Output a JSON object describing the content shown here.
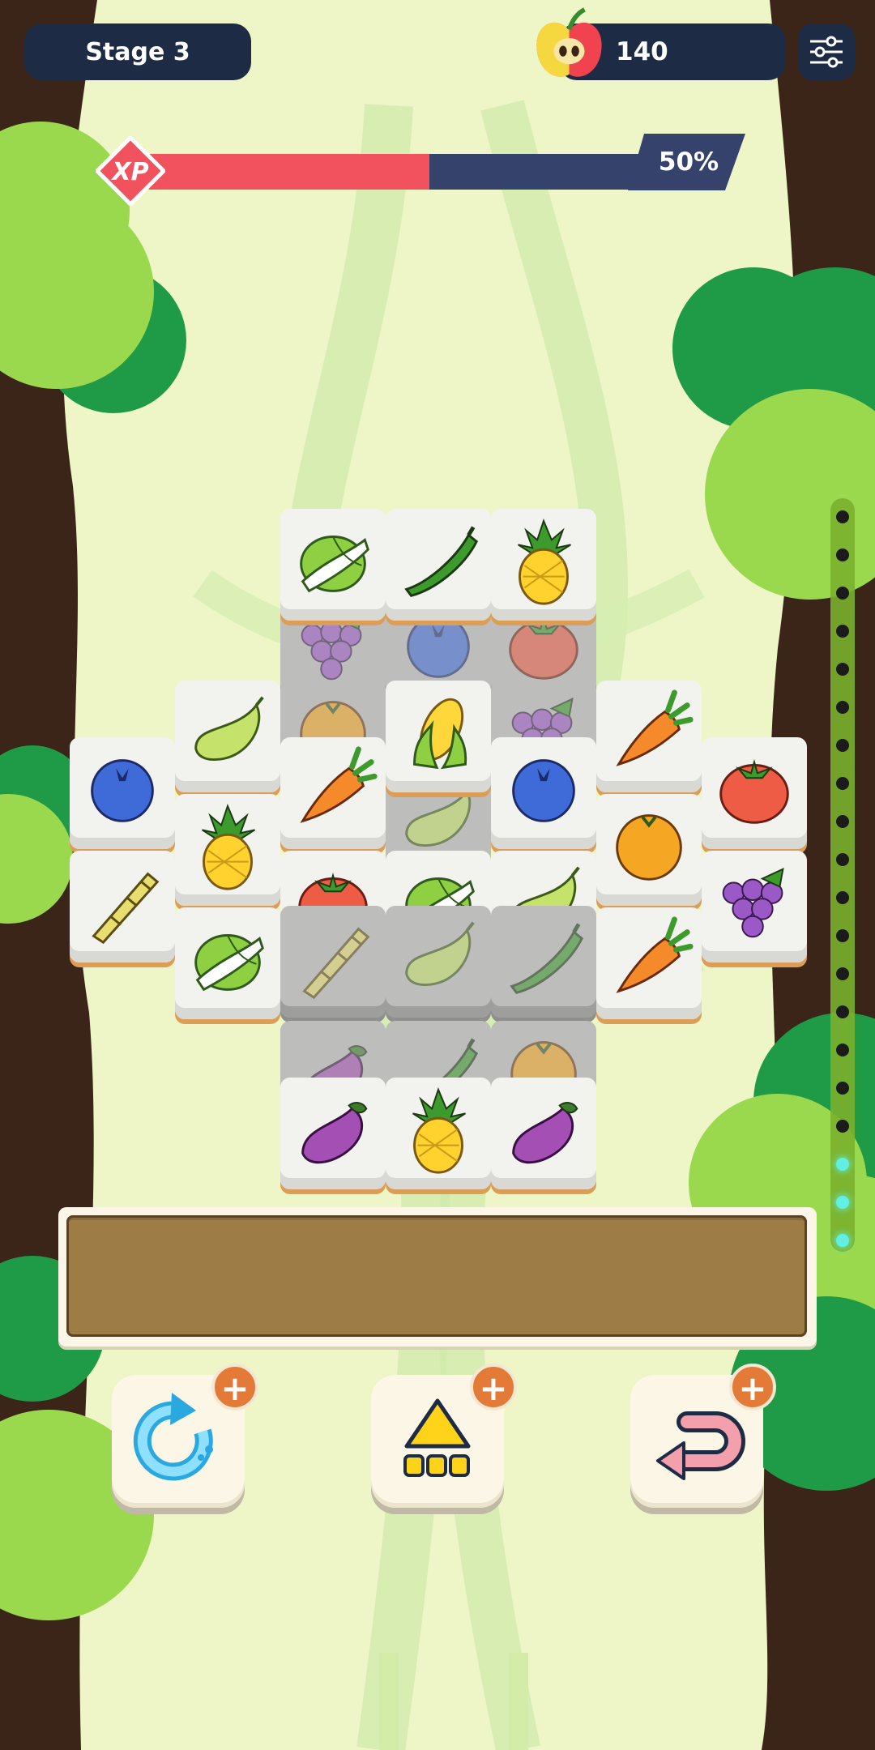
{
  "hud": {
    "stage_label": "Stage 3",
    "coin_count": "140",
    "xp_badge": "XP",
    "xp_percent_label": "50%",
    "xp_progress": 0.5
  },
  "board": {
    "tiles": [
      {
        "name": "grapes",
        "blocked": true
      },
      {
        "name": "blueberry",
        "blocked": true
      },
      {
        "name": "tomato",
        "blocked": true
      },
      {
        "name": "napa-cabbage",
        "blocked": false
      },
      {
        "name": "okra",
        "blocked": false
      },
      {
        "name": "pineapple",
        "blocked": false
      },
      {
        "name": "orange",
        "blocked": true
      },
      {
        "name": "grapes",
        "blocked": true
      },
      {
        "name": "edamame",
        "blocked": true
      },
      {
        "name": "edamame",
        "blocked": false
      },
      {
        "name": "corn",
        "blocked": false
      },
      {
        "name": "carrot",
        "blocked": false
      },
      {
        "name": "blueberry",
        "blocked": false
      },
      {
        "name": "carrot",
        "blocked": false
      },
      {
        "name": "blueberry",
        "blocked": false
      },
      {
        "name": "tomato",
        "blocked": false
      },
      {
        "name": "pineapple",
        "blocked": false
      },
      {
        "name": "orange",
        "blocked": false
      },
      {
        "name": "bamboo-shoot",
        "blocked": false
      },
      {
        "name": "tomato",
        "blocked": false
      },
      {
        "name": "napa-cabbage",
        "blocked": false
      },
      {
        "name": "edamame",
        "blocked": false
      },
      {
        "name": "grapes",
        "blocked": false
      },
      {
        "name": "bamboo-shoot",
        "blocked": true
      },
      {
        "name": "edamame",
        "blocked": true
      },
      {
        "name": "okra",
        "blocked": true
      },
      {
        "name": "napa-cabbage",
        "blocked": false
      },
      {
        "name": "carrot",
        "blocked": false
      },
      {
        "name": "eggplant",
        "blocked": true
      },
      {
        "name": "okra",
        "blocked": true
      },
      {
        "name": "orange",
        "blocked": true
      },
      {
        "name": "eggplant",
        "blocked": false
      },
      {
        "name": "pineapple",
        "blocked": false
      },
      {
        "name": "eggplant",
        "blocked": false
      }
    ]
  },
  "tray": {
    "slots": 7,
    "filled": 0
  },
  "powerups": [
    {
      "name": "shuffle",
      "icon": "shuffle-icon",
      "plus": "+"
    },
    {
      "name": "hint",
      "icon": "hint-icon",
      "plus": "+"
    },
    {
      "name": "undo",
      "icon": "undo-icon",
      "plus": "+"
    }
  ],
  "level_progress": {
    "steps": 20,
    "lit": 3
  },
  "colors": {
    "hud": "#1e2b45",
    "xp_fill": "#f1525d",
    "xp_track": "#35426b",
    "tray": "#9d7c45",
    "plus": "#e47a37"
  }
}
